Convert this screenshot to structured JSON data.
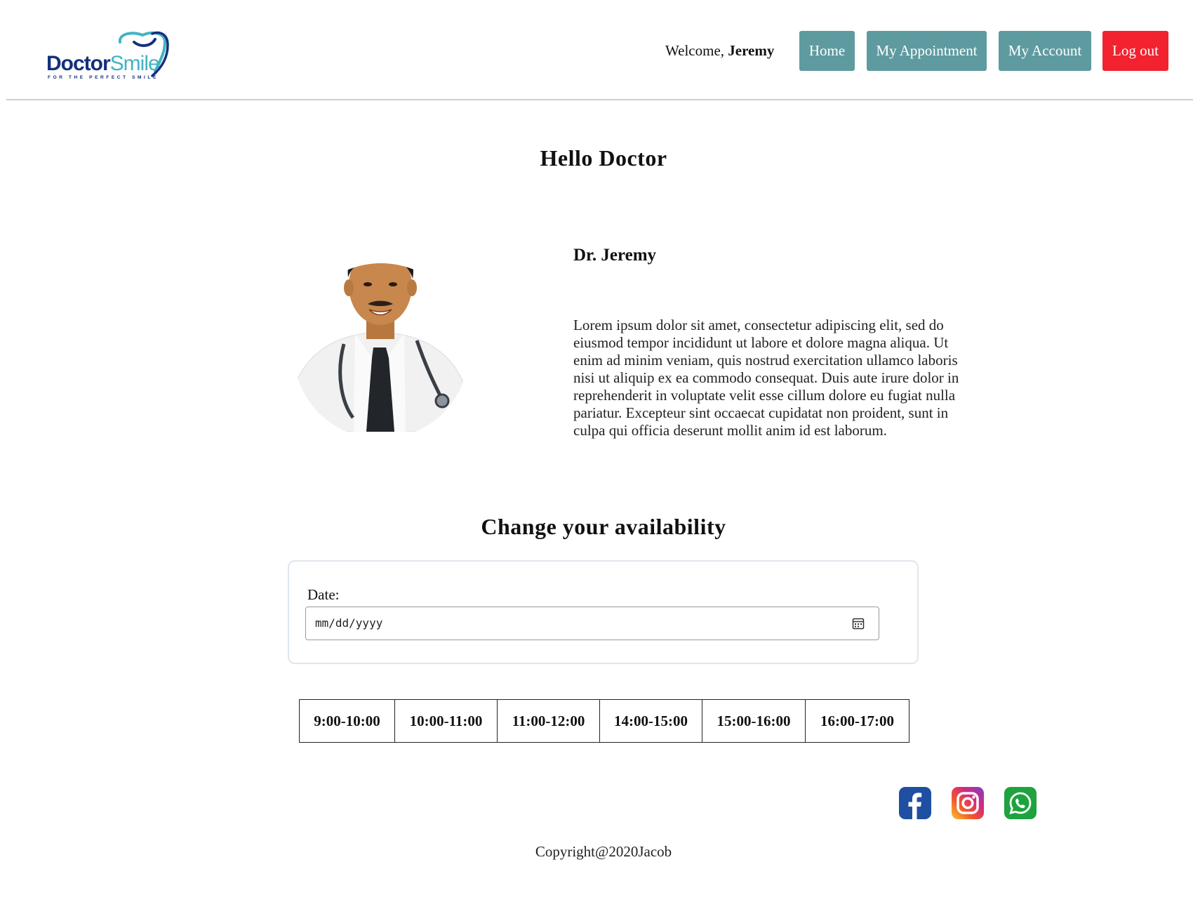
{
  "brand": {
    "name_part1": "Doctor",
    "name_part2": "Smile",
    "tagline": "FOR THE PERFECT SMILE",
    "color_dark": "#14307c",
    "color_light": "#43b3c3"
  },
  "header": {
    "welcome_prefix": "Welcome, ",
    "user_name": "Jeremy",
    "nav": {
      "home": "Home",
      "appointment": "My Appointment",
      "account": "My Account",
      "logout": "Log out"
    },
    "nav_color": "#5e9ba0",
    "logout_color": "#f2222f"
  },
  "main": {
    "title": "Hello Doctor",
    "doctor_name": "Dr. Jeremy",
    "bio": "Lorem ipsum dolor sit amet, consectetur adipiscing elit, sed do eiusmod tempor incididunt ut labore et dolore magna aliqua. Ut enim ad minim veniam, quis nostrud exercitation ullamco laboris nisi ut aliquip ex ea commodo consequat. Duis aute irure dolor in reprehenderit in voluptate velit esse cillum dolore eu fugiat nulla pariatur. Excepteur sint occaecat cupidatat non proident, sunt in culpa qui officia deserunt mollit anim id est laborum."
  },
  "availability": {
    "title": "Change your availability",
    "date_label": "Date:",
    "date_placeholder": "mm/dd/yyyy",
    "slots": [
      "9:00-10:00",
      "10:00-11:00",
      "11:00-12:00",
      "14:00-15:00",
      "15:00-16:00",
      "16:00-17:00"
    ]
  },
  "footer": {
    "social_icons": [
      "facebook-icon",
      "instagram-icon",
      "whatsapp-icon"
    ],
    "copyright": "Copyright@2020Jacob"
  }
}
